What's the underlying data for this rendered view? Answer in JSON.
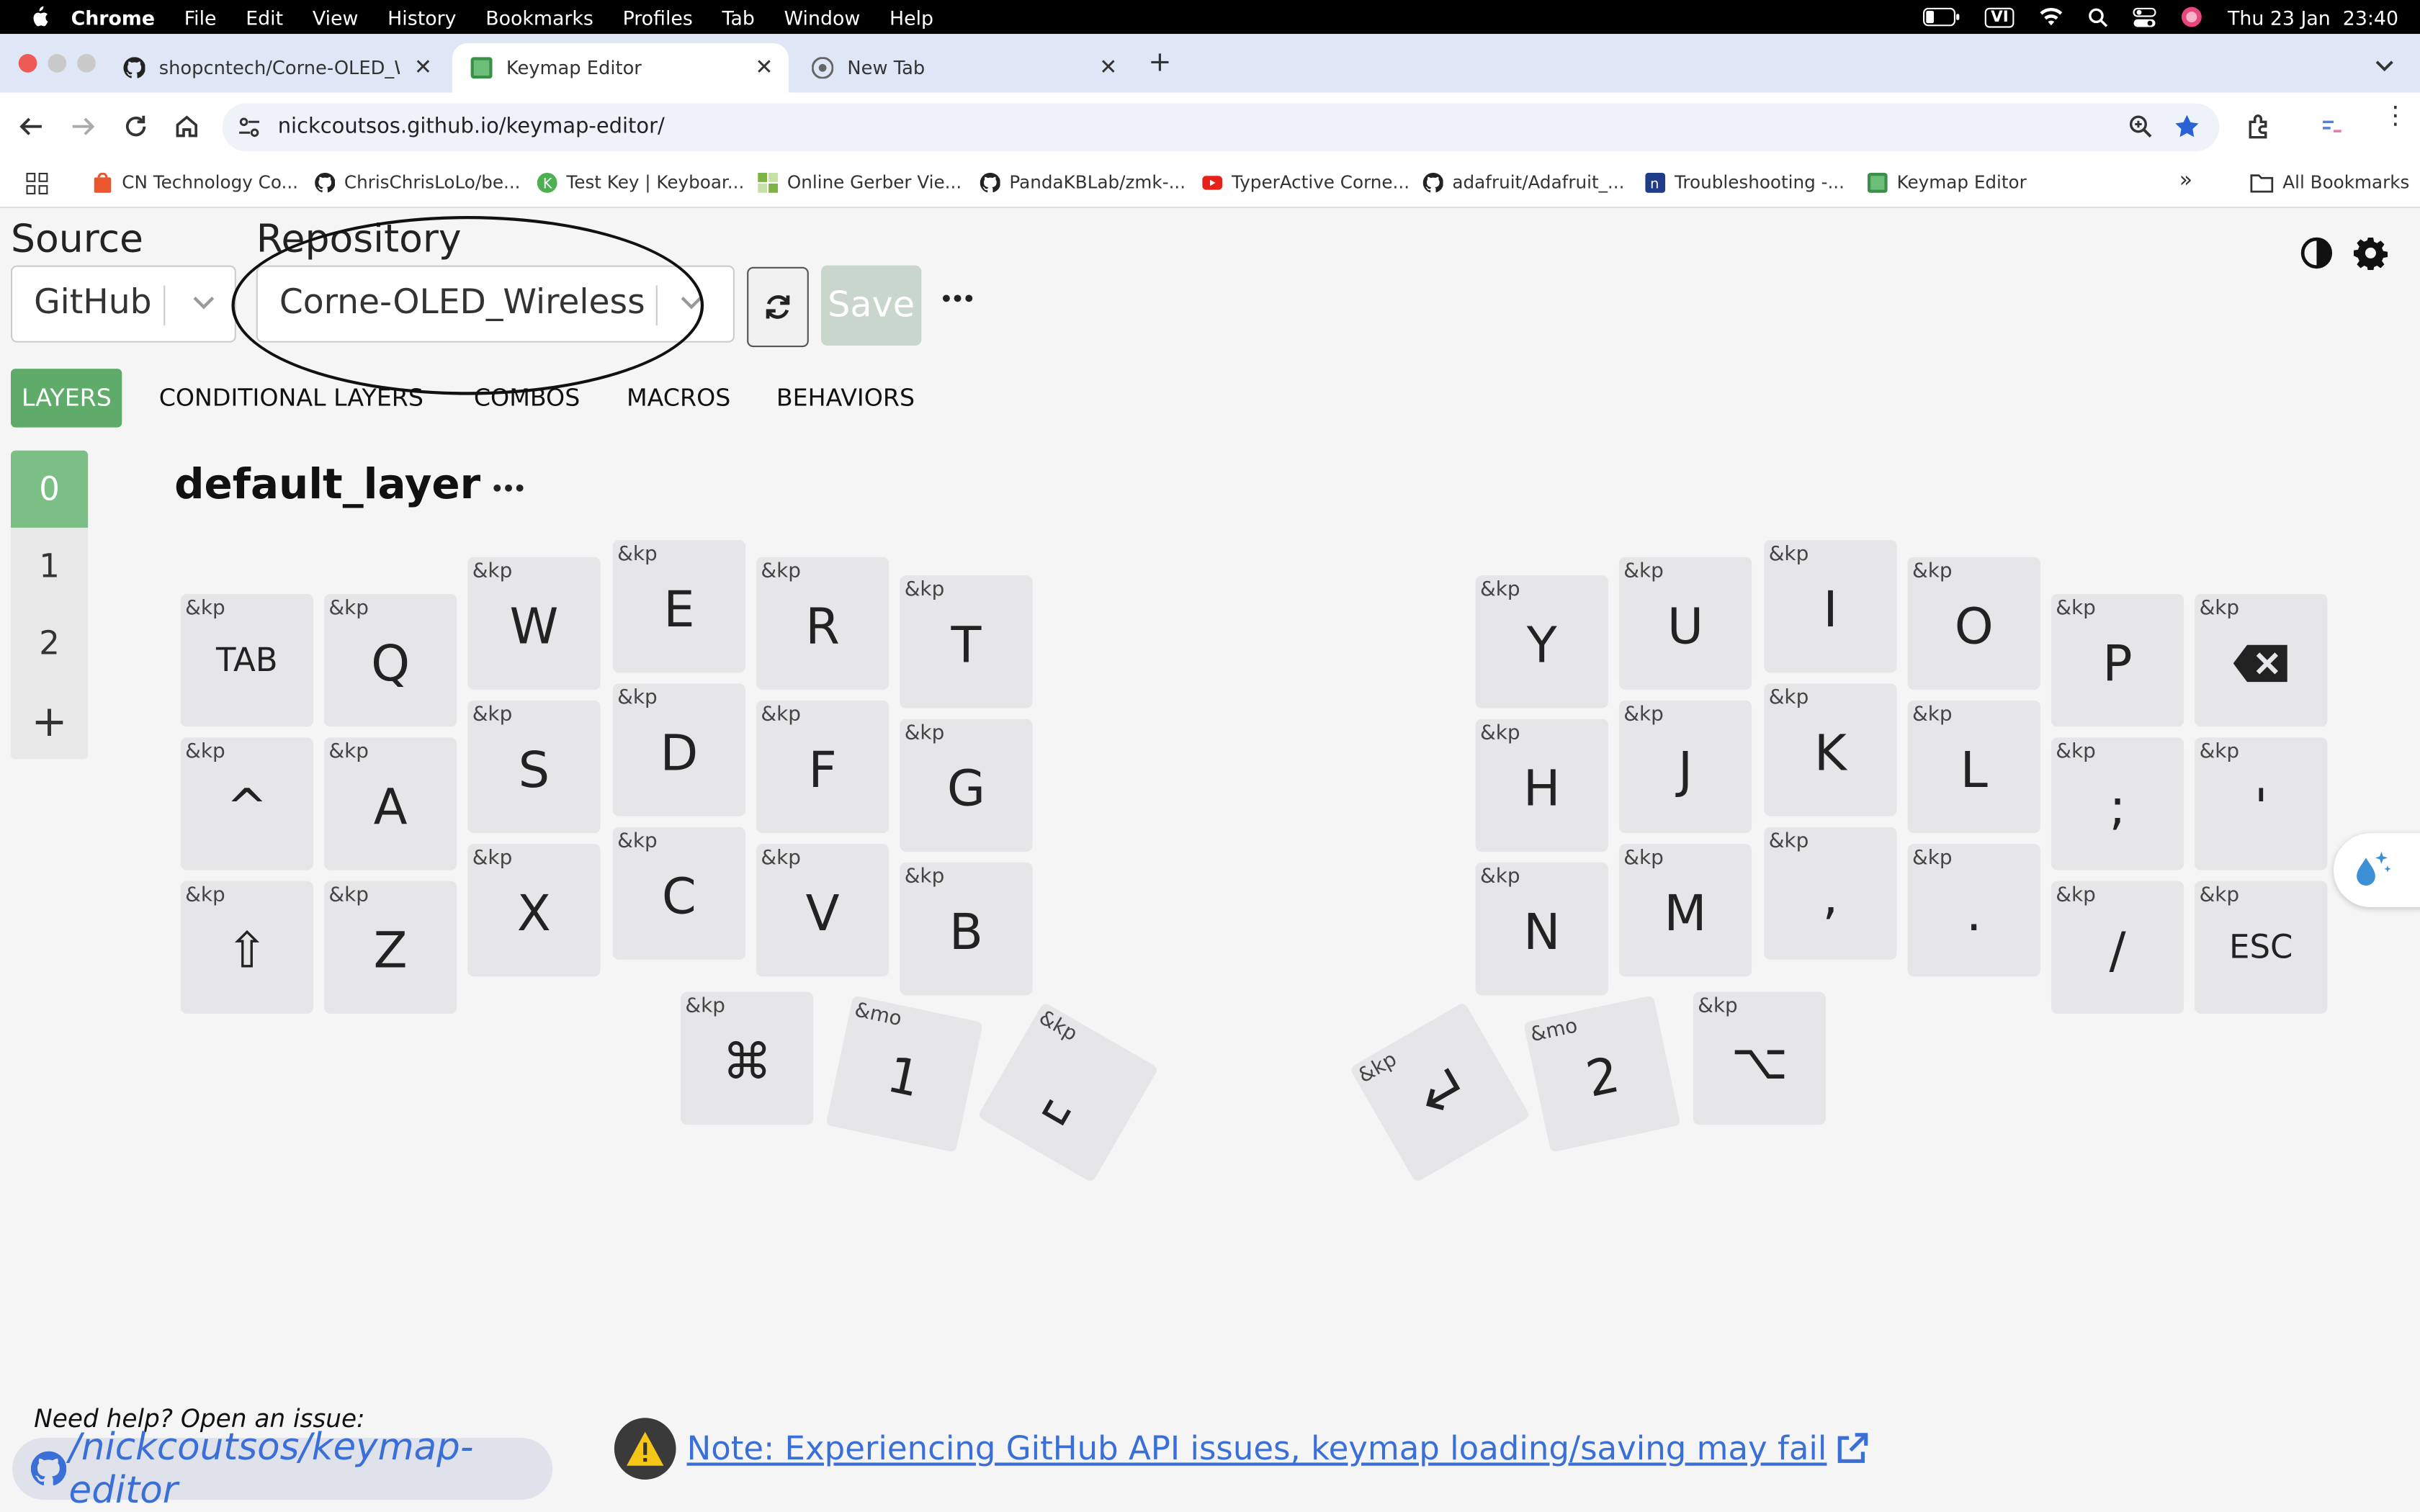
{
  "menubar": {
    "app": "Chrome",
    "items": [
      "File",
      "Edit",
      "View",
      "History",
      "Bookmarks",
      "Profiles",
      "Tab",
      "Window",
      "Help"
    ],
    "input_source": "VI",
    "clock": "Thu 23 Jan  23:40"
  },
  "tabs": [
    {
      "title": "shopcntech/Corne-OLED_Wir",
      "active": false
    },
    {
      "title": "Keymap Editor",
      "active": true
    },
    {
      "title": "New Tab",
      "active": false
    }
  ],
  "address": {
    "url": "nickcoutsos.github.io/keymap-editor/"
  },
  "bookmarks": [
    {
      "label": "CN Technology Co...",
      "icon": "shop-icon"
    },
    {
      "label": "ChrisChrisLoLo/be...",
      "icon": "github-icon"
    },
    {
      "label": "Test Key | Keyboar...",
      "icon": "k-icon"
    },
    {
      "label": "Online Gerber Vie...",
      "icon": "gerber-icon"
    },
    {
      "label": "PandaKBLab/zmk-...",
      "icon": "github-icon"
    },
    {
      "label": "TyperActive Corne...",
      "icon": "youtube-icon"
    },
    {
      "label": "adafruit/Adafruit_...",
      "icon": "github-icon"
    },
    {
      "label": "Troubleshooting -...",
      "icon": "n-icon"
    },
    {
      "label": "Keymap Editor",
      "icon": "keymap-icon"
    }
  ],
  "all_bookmarks": "All Bookmarks",
  "editor": {
    "source_label": "Source",
    "source_value": "GitHub",
    "repo_label": "Repository",
    "repo_value": "Corne-OLED_Wireless",
    "save_label": "Save",
    "more": "•••"
  },
  "nav_tabs": [
    "LAYERS",
    "CONDITIONAL LAYERS",
    "COMBOS",
    "MACROS",
    "BEHAVIORS"
  ],
  "layers": [
    "0",
    "1",
    "2",
    "+"
  ],
  "layer_name": "default_layer",
  "keys": [
    {
      "b": "&kp",
      "p": "TAB"
    },
    {
      "b": "&kp",
      "p": "Q"
    },
    {
      "b": "&kp",
      "p": "W"
    },
    {
      "b": "&kp",
      "p": "E"
    },
    {
      "b": "&kp",
      "p": "R"
    },
    {
      "b": "&kp",
      "p": "T"
    },
    {
      "b": "&kp",
      "p": "^"
    },
    {
      "b": "&kp",
      "p": "A"
    },
    {
      "b": "&kp",
      "p": "S"
    },
    {
      "b": "&kp",
      "p": "D"
    },
    {
      "b": "&kp",
      "p": "F"
    },
    {
      "b": "&kp",
      "p": "G"
    },
    {
      "b": "&kp",
      "p": "⇧"
    },
    {
      "b": "&kp",
      "p": "Z"
    },
    {
      "b": "&kp",
      "p": "X"
    },
    {
      "b": "&kp",
      "p": "C"
    },
    {
      "b": "&kp",
      "p": "V"
    },
    {
      "b": "&kp",
      "p": "B"
    },
    {
      "b": "&kp",
      "p": "⌘"
    },
    {
      "b": "&mo",
      "p": "1"
    },
    {
      "b": "&kp",
      "p": "␣"
    },
    {
      "b": "&kp",
      "p": "Y"
    },
    {
      "b": "&kp",
      "p": "U"
    },
    {
      "b": "&kp",
      "p": "I"
    },
    {
      "b": "&kp",
      "p": "O"
    },
    {
      "b": "&kp",
      "p": "P"
    },
    {
      "b": "&kp",
      "p": "backspace-icon"
    },
    {
      "b": "&kp",
      "p": "H"
    },
    {
      "b": "&kp",
      "p": "J"
    },
    {
      "b": "&kp",
      "p": "K"
    },
    {
      "b": "&kp",
      "p": "L"
    },
    {
      "b": "&kp",
      "p": ";"
    },
    {
      "b": "&kp",
      "p": "'"
    },
    {
      "b": "&kp",
      "p": "N"
    },
    {
      "b": "&kp",
      "p": "M"
    },
    {
      "b": "&kp",
      "p": ","
    },
    {
      "b": "&kp",
      "p": "."
    },
    {
      "b": "&kp",
      "p": "/"
    },
    {
      "b": "&kp",
      "p": "ESC"
    },
    {
      "b": "&kp",
      "p": "enter-icon"
    },
    {
      "b": "&mo",
      "p": "2"
    },
    {
      "b": "&kp",
      "p": "⌥"
    }
  ],
  "footer": {
    "help": "Need help? Open an issue:",
    "repo_link": "/nickcoutsos/keymap-editor",
    "note": "Note: Experiencing GitHub API issues, keymap loading/saving may fail"
  },
  "colors": {
    "accent": "#5fab6a",
    "link": "#3a6fd8",
    "key": "#e6e6e8"
  }
}
